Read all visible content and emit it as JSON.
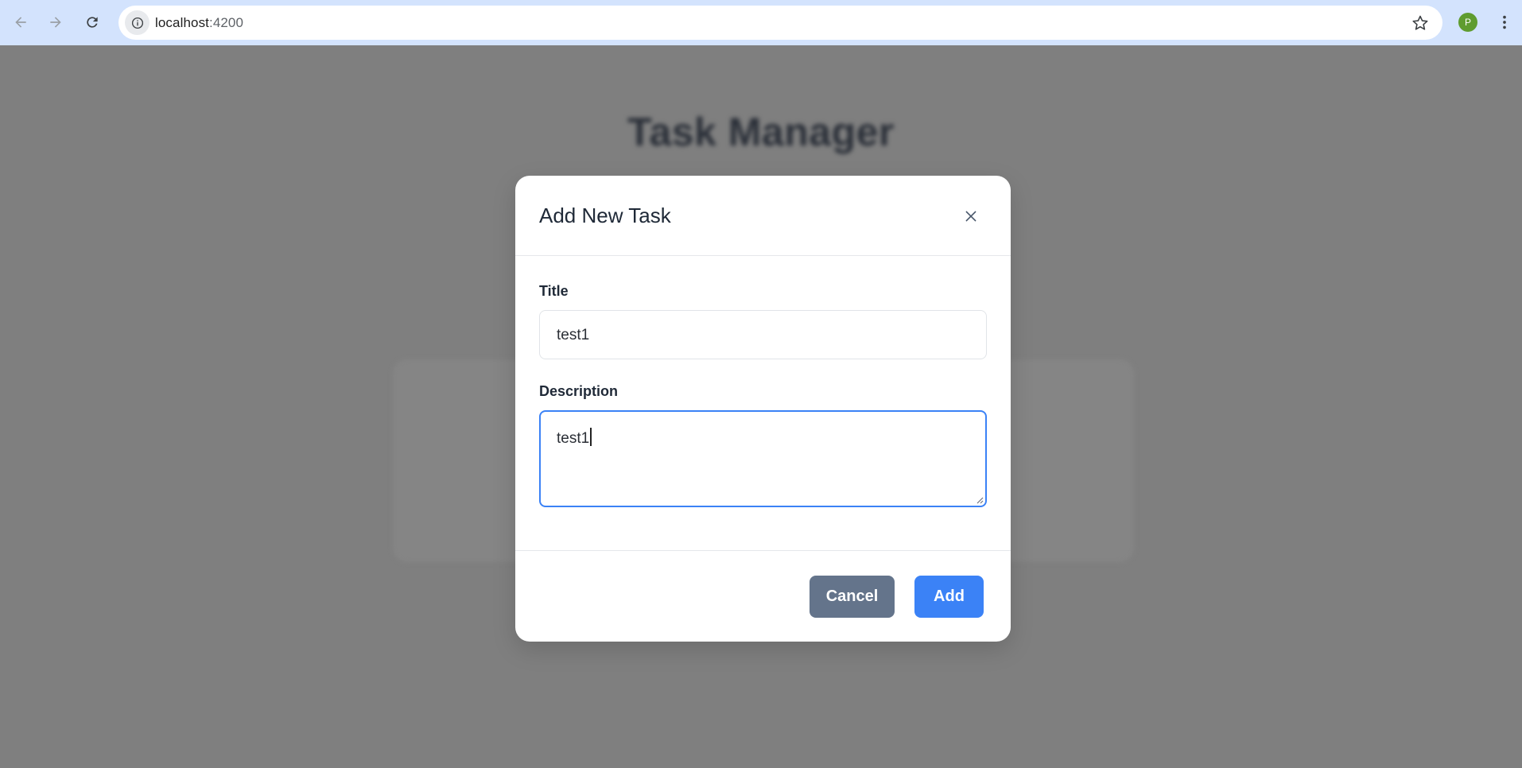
{
  "browser": {
    "url_host": "localhost",
    "url_port": ":4200",
    "profile_initial": "P"
  },
  "page": {
    "title": "Task Manager"
  },
  "modal": {
    "title": "Add New Task",
    "fields": {
      "title_label": "Title",
      "title_value": "test1",
      "description_label": "Description",
      "description_value": "test1"
    },
    "buttons": {
      "cancel": "Cancel",
      "add": "Add"
    }
  },
  "colors": {
    "primary": "#3b82f6",
    "secondary": "#64748b",
    "overlay": "#7f7f7f",
    "chrome": "#d3e3fd"
  }
}
